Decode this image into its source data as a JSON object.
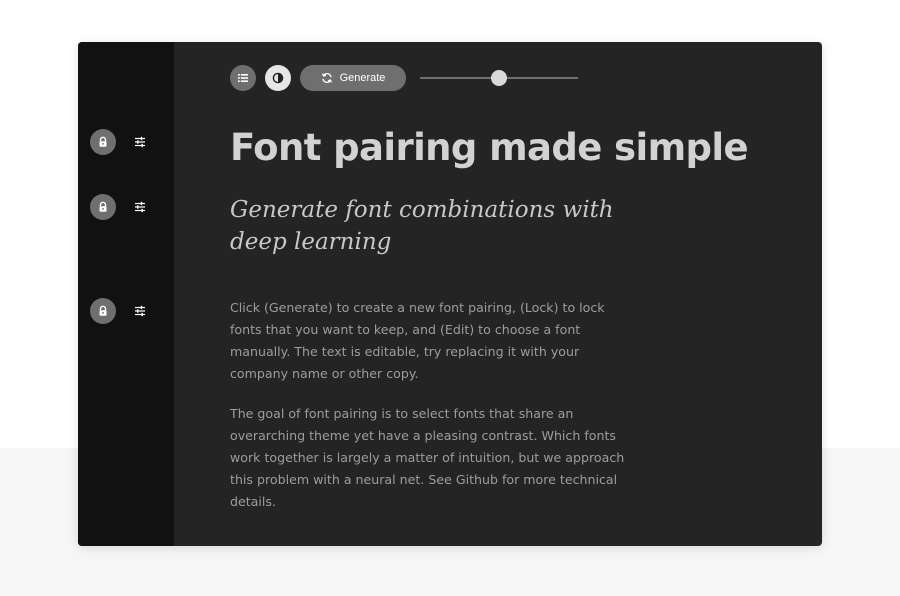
{
  "sidebar": {
    "rows": [
      {
        "lock_icon": "lock-icon",
        "edit_icon": "sliders-icon"
      },
      {
        "lock_icon": "lock-icon",
        "edit_icon": "sliders-icon"
      },
      {
        "lock_icon": "lock-icon",
        "edit_icon": "sliders-icon"
      }
    ]
  },
  "toolbar": {
    "list_icon": "list-icon",
    "theme_icon": "contrast-icon",
    "generate_icon": "refresh-icon",
    "generate_label": "Generate",
    "slider_value": 0.5
  },
  "content": {
    "headline": "Font pairing made simple",
    "subhead": "Generate font combinations with deep learning",
    "paragraph1": "Click (Generate) to create a new font pairing, (Lock) to lock fonts that you want to keep, and (Edit) to choose a font manually. The text is editable, try replacing it with your company name or other copy.",
    "paragraph2": "The goal of font pairing is to select fonts that share an overarching theme yet have a pleasing contrast. Which fonts work together is largely a matter of intuition, but we approach this problem with a neural net. See Github for more technical details."
  },
  "colors": {
    "sidebar_bg": "#111111",
    "main_bg": "#242424",
    "button_grey": "#6f6f6f",
    "headline": "#d2d2d2",
    "body_text": "#9d9d9d"
  }
}
